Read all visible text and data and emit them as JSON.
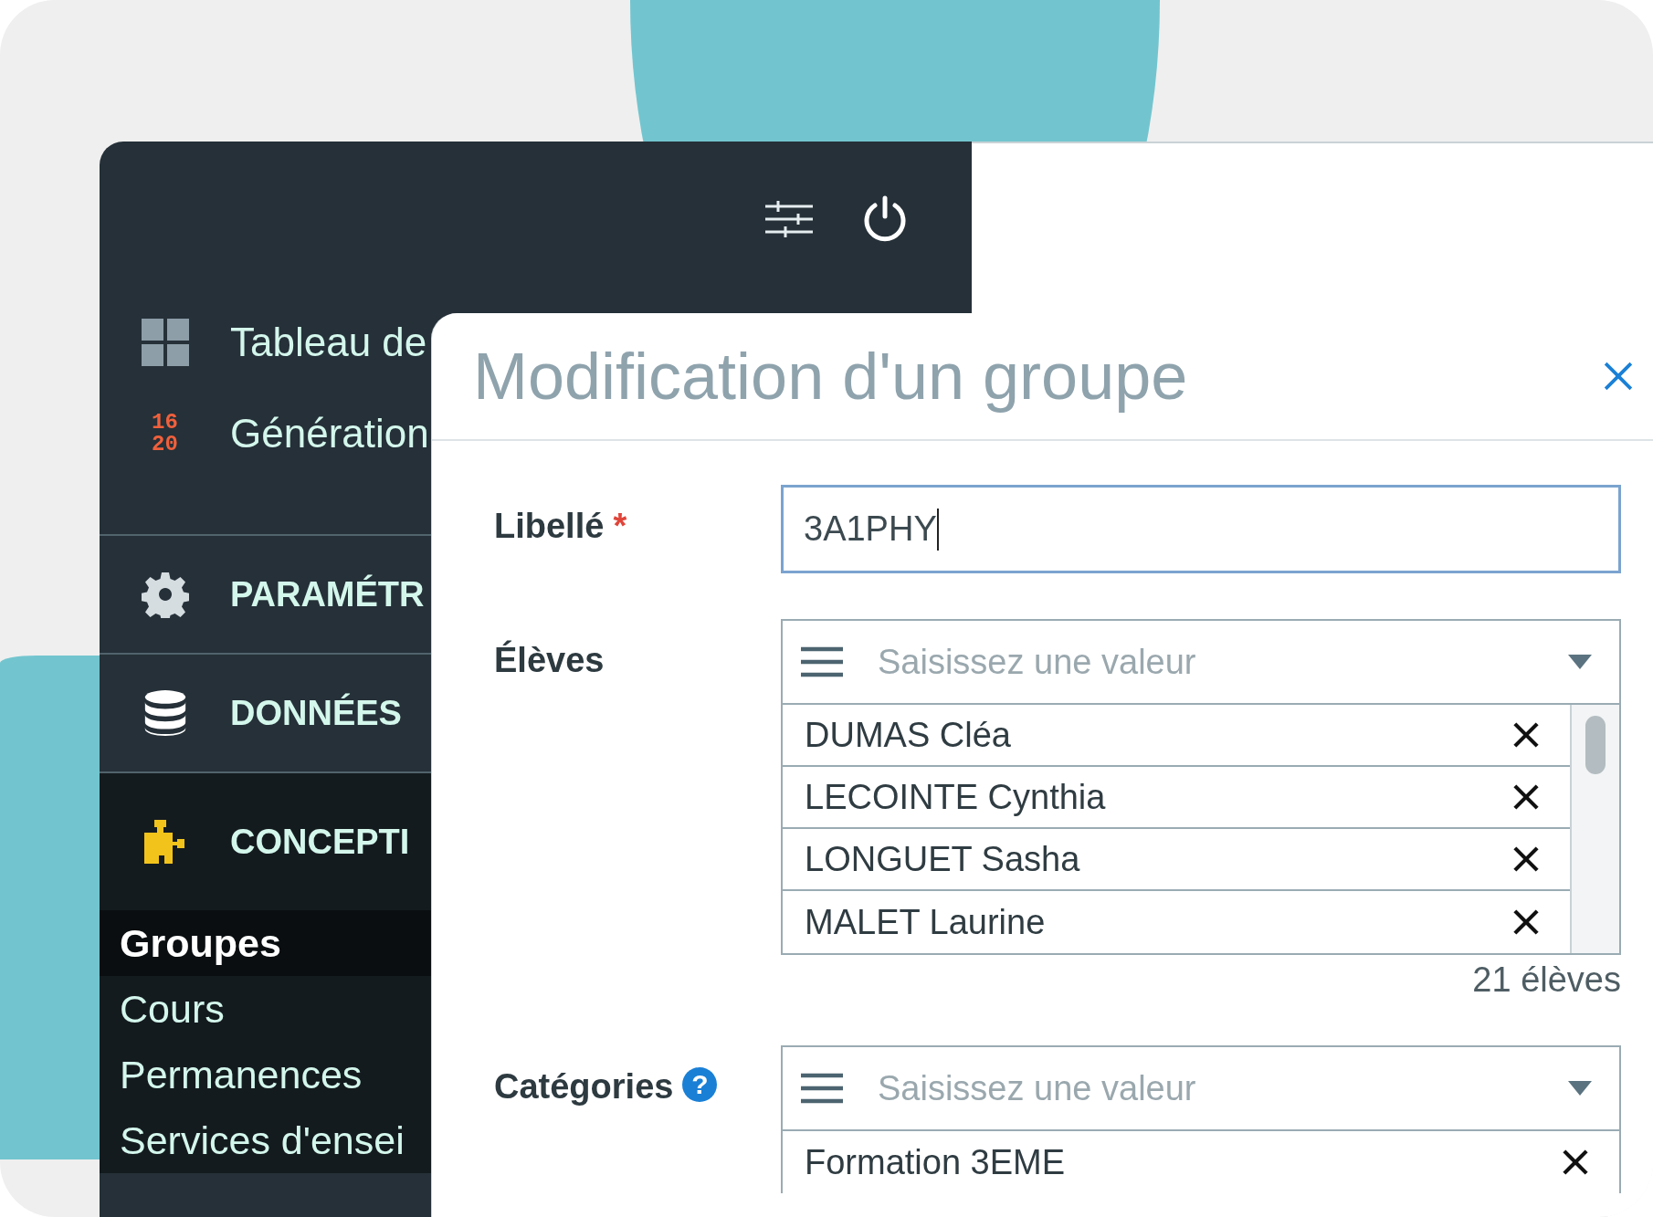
{
  "toolbar": {
    "buttons": [
      {
        "kind": "sliders"
      },
      {
        "kind": "power"
      }
    ]
  },
  "sidebar": {
    "top_items": [
      {
        "kind": "grid",
        "label": "Tableau de"
      },
      {
        "kind": "score",
        "icon_text": [
          "16",
          "20"
        ],
        "label": "Génération"
      }
    ],
    "sections": [
      {
        "kind": "gear",
        "label": "PARAMÉTR",
        "expanded": false
      },
      {
        "kind": "database",
        "label": "DONNÉES",
        "expanded": false
      },
      {
        "kind": "puzzle",
        "label": "CONCEPTI",
        "expanded": true,
        "children": [
          {
            "label": "Groupes",
            "selected": true
          },
          {
            "label": "Cours",
            "selected": false
          },
          {
            "label": "Permanences",
            "selected": false
          },
          {
            "label": "Services d'ensei",
            "selected": false
          }
        ]
      }
    ]
  },
  "dialog": {
    "title": "Modification d'un groupe",
    "fields": [
      {
        "kind": "text",
        "label": "Libellé",
        "required_mark": "*",
        "value": "3A1PHY",
        "focused": true
      },
      {
        "kind": "multiselect",
        "label": "Élèves",
        "placeholder": "Saisissez une valeur",
        "items": [
          "DUMAS Cléa",
          "LECOINTE Cynthia",
          "LONGUET Sasha",
          "MALET Laurine"
        ],
        "count": "21 élèves"
      },
      {
        "kind": "multiselect",
        "label": "Catégories",
        "help_mark": "?",
        "placeholder": "Saisissez une valeur",
        "items": [
          "Formation 3EME"
        ]
      }
    ]
  }
}
